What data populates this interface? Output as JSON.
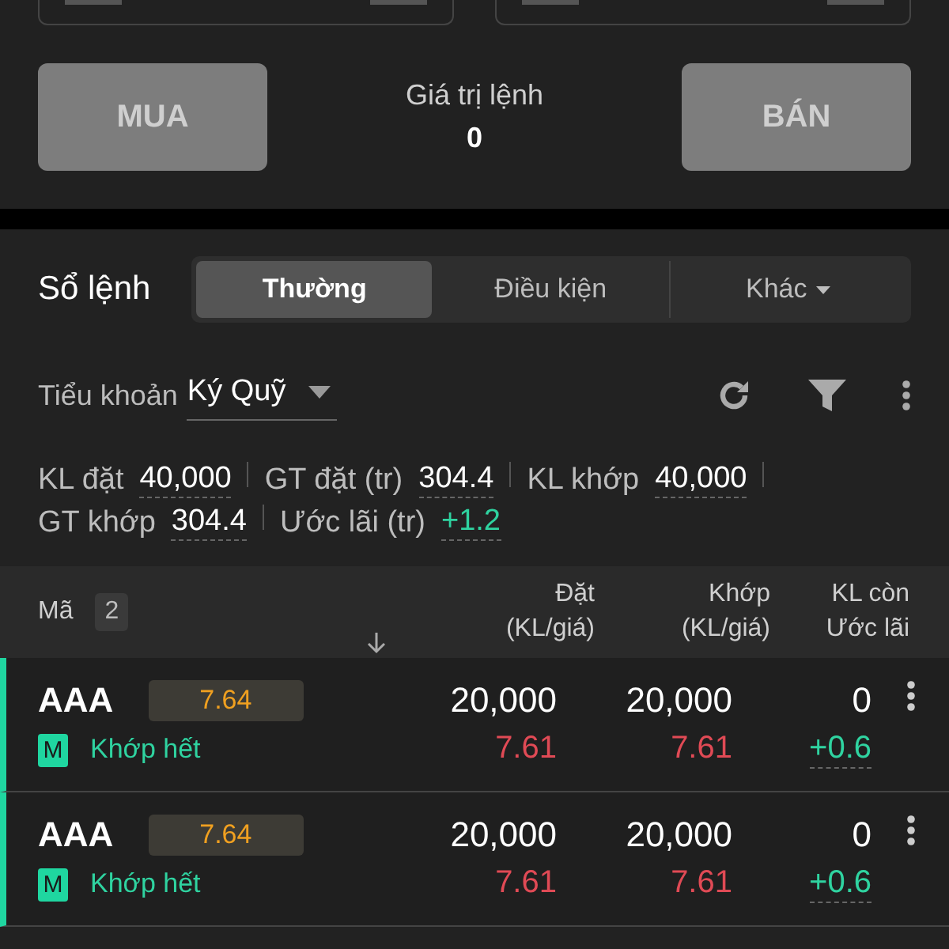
{
  "order_entry": {
    "buy_label": "MUA",
    "sell_label": "BÁN",
    "value_label": "Giá trị lệnh",
    "value": "0"
  },
  "order_book": {
    "title": "Sổ lệnh",
    "tabs": [
      {
        "label": "Thường",
        "selected": true,
        "kind": "plain"
      },
      {
        "label": "Điều kiện",
        "selected": false,
        "kind": "plain"
      },
      {
        "label": "Khác",
        "selected": false,
        "kind": "dropdown"
      }
    ],
    "subaccount": {
      "label": "Tiểu khoản",
      "value": "Ký Quỹ"
    },
    "stats": [
      {
        "label": "KL đặt",
        "value": "40,000",
        "positive": false
      },
      {
        "label": "GT đặt (tr)",
        "value": "304.4",
        "positive": false
      },
      {
        "label": "KL khớp",
        "value": "40,000",
        "positive": false
      },
      {
        "label": "GT khớp",
        "value": "304.4",
        "positive": false
      },
      {
        "label": "Ước lãi (tr)",
        "value": "+1.2",
        "positive": true
      }
    ],
    "table": {
      "symbol_header": "Mã",
      "count": "2",
      "placed_header": [
        "Đặt",
        "(KL/giá)"
      ],
      "matched_header": [
        "Khớp",
        "(KL/giá)"
      ],
      "remain_header": [
        "KL còn",
        "Ước lãi"
      ],
      "rows": [
        {
          "symbol": "AAA",
          "price": "7.64",
          "type": "M",
          "status": "Khớp hết",
          "placed_qty": "20,000",
          "placed_price": "7.61",
          "matched_qty": "20,000",
          "matched_price": "7.61",
          "remaining": "0",
          "profit": "+0.6"
        },
        {
          "symbol": "AAA",
          "price": "7.64",
          "type": "M",
          "status": "Khớp hết",
          "placed_qty": "20,000",
          "placed_price": "7.61",
          "matched_qty": "20,000",
          "matched_price": "7.61",
          "remaining": "0",
          "profit": "+0.6"
        }
      ]
    }
  }
}
